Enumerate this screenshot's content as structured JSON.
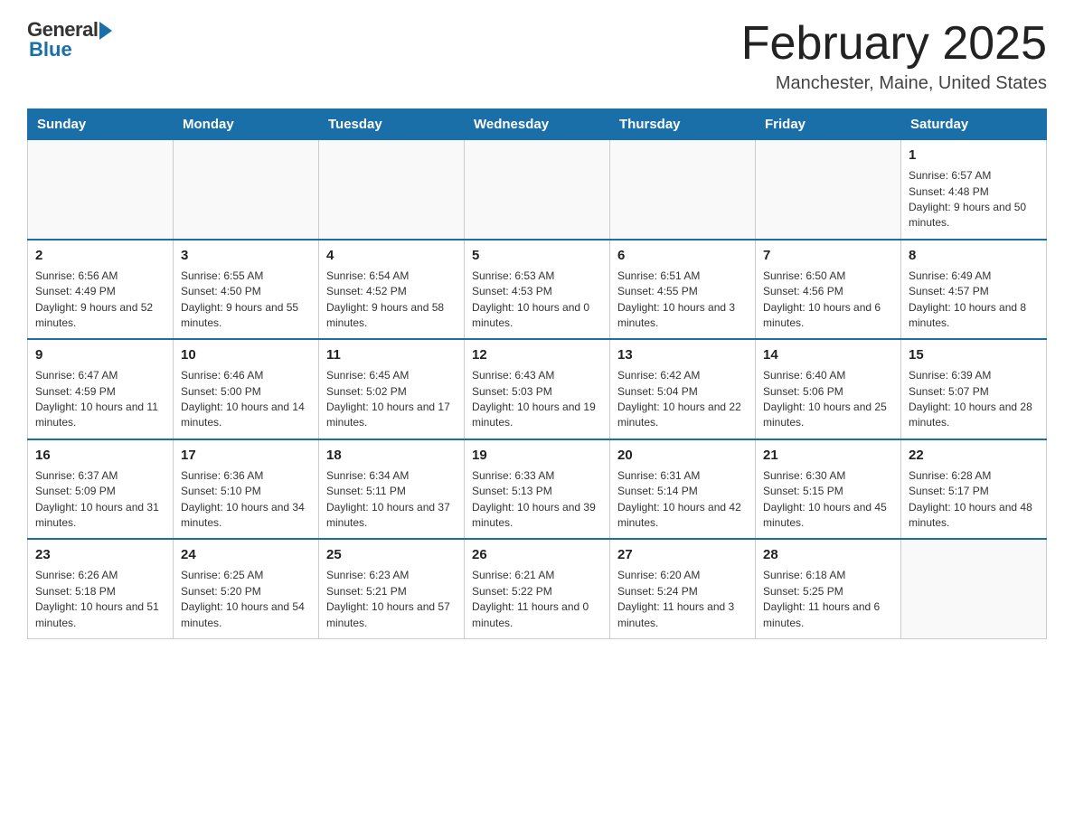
{
  "logo": {
    "general": "General",
    "blue": "Blue"
  },
  "title": "February 2025",
  "location": "Manchester, Maine, United States",
  "days_header": [
    "Sunday",
    "Monday",
    "Tuesday",
    "Wednesday",
    "Thursday",
    "Friday",
    "Saturday"
  ],
  "weeks": [
    [
      {
        "date": "",
        "info": ""
      },
      {
        "date": "",
        "info": ""
      },
      {
        "date": "",
        "info": ""
      },
      {
        "date": "",
        "info": ""
      },
      {
        "date": "",
        "info": ""
      },
      {
        "date": "",
        "info": ""
      },
      {
        "date": "1",
        "info": "Sunrise: 6:57 AM\nSunset: 4:48 PM\nDaylight: 9 hours and 50 minutes."
      }
    ],
    [
      {
        "date": "2",
        "info": "Sunrise: 6:56 AM\nSunset: 4:49 PM\nDaylight: 9 hours and 52 minutes."
      },
      {
        "date": "3",
        "info": "Sunrise: 6:55 AM\nSunset: 4:50 PM\nDaylight: 9 hours and 55 minutes."
      },
      {
        "date": "4",
        "info": "Sunrise: 6:54 AM\nSunset: 4:52 PM\nDaylight: 9 hours and 58 minutes."
      },
      {
        "date": "5",
        "info": "Sunrise: 6:53 AM\nSunset: 4:53 PM\nDaylight: 10 hours and 0 minutes."
      },
      {
        "date": "6",
        "info": "Sunrise: 6:51 AM\nSunset: 4:55 PM\nDaylight: 10 hours and 3 minutes."
      },
      {
        "date": "7",
        "info": "Sunrise: 6:50 AM\nSunset: 4:56 PM\nDaylight: 10 hours and 6 minutes."
      },
      {
        "date": "8",
        "info": "Sunrise: 6:49 AM\nSunset: 4:57 PM\nDaylight: 10 hours and 8 minutes."
      }
    ],
    [
      {
        "date": "9",
        "info": "Sunrise: 6:47 AM\nSunset: 4:59 PM\nDaylight: 10 hours and 11 minutes."
      },
      {
        "date": "10",
        "info": "Sunrise: 6:46 AM\nSunset: 5:00 PM\nDaylight: 10 hours and 14 minutes."
      },
      {
        "date": "11",
        "info": "Sunrise: 6:45 AM\nSunset: 5:02 PM\nDaylight: 10 hours and 17 minutes."
      },
      {
        "date": "12",
        "info": "Sunrise: 6:43 AM\nSunset: 5:03 PM\nDaylight: 10 hours and 19 minutes."
      },
      {
        "date": "13",
        "info": "Sunrise: 6:42 AM\nSunset: 5:04 PM\nDaylight: 10 hours and 22 minutes."
      },
      {
        "date": "14",
        "info": "Sunrise: 6:40 AM\nSunset: 5:06 PM\nDaylight: 10 hours and 25 minutes."
      },
      {
        "date": "15",
        "info": "Sunrise: 6:39 AM\nSunset: 5:07 PM\nDaylight: 10 hours and 28 minutes."
      }
    ],
    [
      {
        "date": "16",
        "info": "Sunrise: 6:37 AM\nSunset: 5:09 PM\nDaylight: 10 hours and 31 minutes."
      },
      {
        "date": "17",
        "info": "Sunrise: 6:36 AM\nSunset: 5:10 PM\nDaylight: 10 hours and 34 minutes."
      },
      {
        "date": "18",
        "info": "Sunrise: 6:34 AM\nSunset: 5:11 PM\nDaylight: 10 hours and 37 minutes."
      },
      {
        "date": "19",
        "info": "Sunrise: 6:33 AM\nSunset: 5:13 PM\nDaylight: 10 hours and 39 minutes."
      },
      {
        "date": "20",
        "info": "Sunrise: 6:31 AM\nSunset: 5:14 PM\nDaylight: 10 hours and 42 minutes."
      },
      {
        "date": "21",
        "info": "Sunrise: 6:30 AM\nSunset: 5:15 PM\nDaylight: 10 hours and 45 minutes."
      },
      {
        "date": "22",
        "info": "Sunrise: 6:28 AM\nSunset: 5:17 PM\nDaylight: 10 hours and 48 minutes."
      }
    ],
    [
      {
        "date": "23",
        "info": "Sunrise: 6:26 AM\nSunset: 5:18 PM\nDaylight: 10 hours and 51 minutes."
      },
      {
        "date": "24",
        "info": "Sunrise: 6:25 AM\nSunset: 5:20 PM\nDaylight: 10 hours and 54 minutes."
      },
      {
        "date": "25",
        "info": "Sunrise: 6:23 AM\nSunset: 5:21 PM\nDaylight: 10 hours and 57 minutes."
      },
      {
        "date": "26",
        "info": "Sunrise: 6:21 AM\nSunset: 5:22 PM\nDaylight: 11 hours and 0 minutes."
      },
      {
        "date": "27",
        "info": "Sunrise: 6:20 AM\nSunset: 5:24 PM\nDaylight: 11 hours and 3 minutes."
      },
      {
        "date": "28",
        "info": "Sunrise: 6:18 AM\nSunset: 5:25 PM\nDaylight: 11 hours and 6 minutes."
      },
      {
        "date": "",
        "info": ""
      }
    ]
  ]
}
